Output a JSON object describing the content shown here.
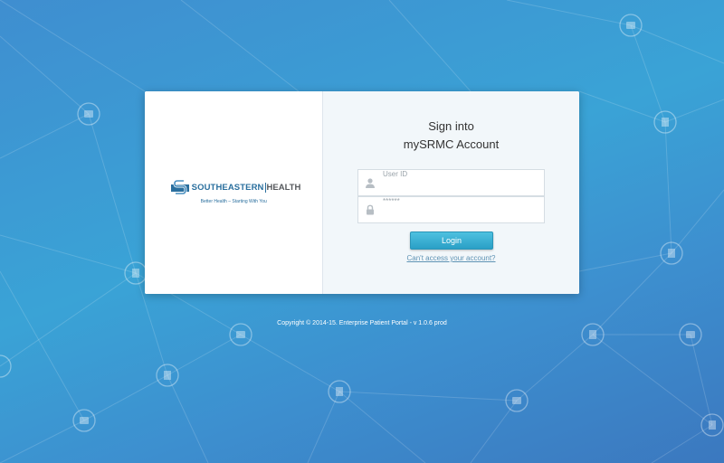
{
  "background": {
    "gradient_colors": [
      "#3f8ed0",
      "#3aa3d6",
      "#3b78bf"
    ],
    "decor_icons": [
      "hospital-building-icon",
      "medical-kit-icon"
    ]
  },
  "logo": {
    "name_part1": "SOUTHEASTERN",
    "name_part2": "HEALTH",
    "tagline": "Better Health – Starting With You",
    "brand_color": "#2a6f9e"
  },
  "login": {
    "title_line1": "Sign into",
    "title_line2": "mySRMC Account",
    "user_id_label": "User ID",
    "user_id_value": "",
    "password_label": "******",
    "password_value": "",
    "user_icon": "user-icon",
    "lock_icon": "lock-icon",
    "login_button": "Login",
    "button_color": "#2a9fc6",
    "forgot_link": "Can't access your account?"
  },
  "footer": {
    "copyright": "Copyright © 2014-15. Enterprise Patient Portal - v 1.0.6 prod"
  }
}
